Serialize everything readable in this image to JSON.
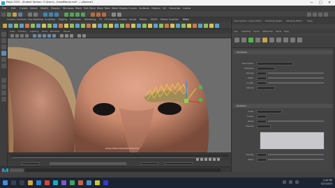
{
  "window": {
    "title": "Maya 2023 - Student Version: C:\\Users\\...\\headMorph.mb* --- pSphere1",
    "minimize": "—",
    "maximize": "□",
    "close": "✕"
  },
  "menu": {
    "items": [
      "File",
      "Edit",
      "Create",
      "Select",
      "Modify",
      "Display",
      "Windows",
      "Mesh",
      "Edit Mesh",
      "Mesh Tools",
      "Mesh Display",
      "Curves",
      "Surfaces",
      "Deform",
      "UV",
      "Generate",
      "Cache"
    ],
    "workspace_label": "Workspace: Maya Classic"
  },
  "shelf": {
    "tabs": [
      "Curves / Surfaces",
      "Poly Modeling",
      "Sculpting",
      "Rigging",
      "Animation",
      "Rendering",
      "FX",
      "FX Caching",
      "Custom",
      "Arnold",
      "Bifrost",
      "MASH",
      "Motion Graphics",
      "XGen"
    ]
  },
  "panel": {
    "menu": [
      "View",
      "Shading",
      "Lighting",
      "Show",
      "Renderer",
      "Panels"
    ],
    "caption": "persp (XGen Interactive Groom)"
  },
  "attribute_editor": {
    "tabs": [
      "Channel Box / Layer Editor",
      "Modeling Toolkit",
      "Attribute Editor",
      "XGen"
    ],
    "menu": [
      "List",
      "Selected",
      "Focus",
      "Attributes",
      "Show",
      "Help"
    ],
    "section_1": "Primitives",
    "section_2": "Modifiers",
    "fields_1": [
      "Description:",
      "Sampling:",
      "Density:",
      "Width:",
      "Length:",
      "Splines:"
    ],
    "fields_2": [
      "Scale:",
      "Clump:",
      "Noise:",
      "Preview:",
      "Density:",
      "Taper:"
    ]
  },
  "colors": {
    "accent": "#5c8fb8",
    "maya_teal": "#19a9c5",
    "guide_yellow": "#e3c93a"
  },
  "taskbar": {
    "time": "2:45 PM",
    "date": "3/27/2023"
  }
}
